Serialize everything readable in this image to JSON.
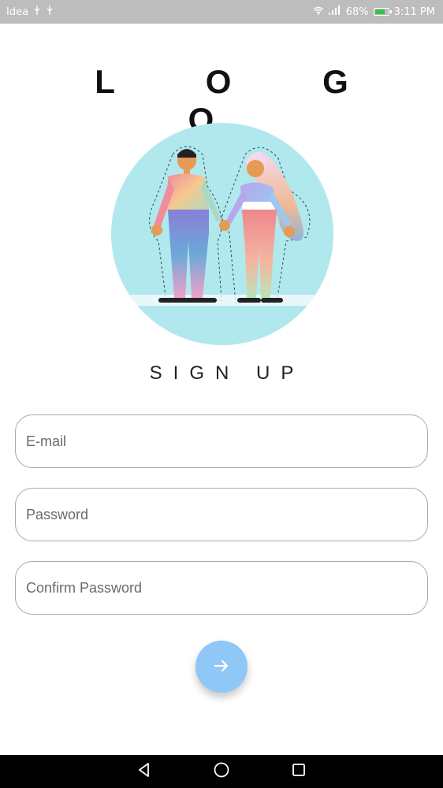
{
  "status_bar": {
    "carrier": "Idea",
    "battery_percent": "68%",
    "battery_level": 0.68,
    "time": "3:11 PM"
  },
  "logo": {
    "text": "L O G O"
  },
  "illustration": {
    "description_icon": "couple-holding-hands-illustration",
    "circle_color": "#b1e8ee"
  },
  "title": "SIGN UP",
  "form": {
    "email_placeholder": "E-mail",
    "password_placeholder": "Password",
    "confirm_password_placeholder": "Confirm Password"
  },
  "submit": {
    "icon": "arrow-right-icon",
    "color": "#8fc7f7"
  },
  "nav": {
    "back_icon": "back-triangle-icon",
    "home_icon": "home-circle-icon",
    "recents_icon": "recents-square-icon"
  }
}
